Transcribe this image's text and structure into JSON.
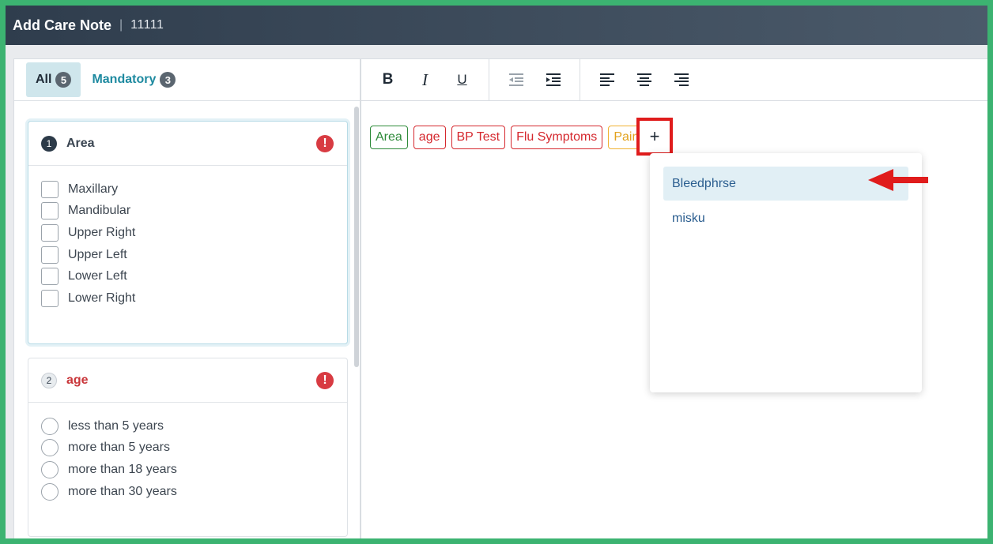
{
  "header": {
    "title": "Add Care Note",
    "separator": "|",
    "code": "11111"
  },
  "tabs": [
    {
      "label": "All",
      "count": "5"
    },
    {
      "label": "Mandatory",
      "count": "3"
    }
  ],
  "cards": [
    {
      "number": "1",
      "title": "Area",
      "alert": "!",
      "options": [
        "Maxillary",
        "Mandibular",
        "Upper Right",
        "Upper Left",
        "Lower Left",
        "Lower Right"
      ]
    },
    {
      "number": "2",
      "title": "age",
      "alert": "!",
      "options": [
        "less than 5 years",
        "more than 5 years",
        "more than 18 years",
        "more than 30 years"
      ]
    }
  ],
  "toolbar": {
    "bold": "B",
    "italic": "I",
    "underline": "U"
  },
  "chips": [
    "Area",
    "age",
    "BP Test",
    "Flu Symptoms",
    "Pain"
  ],
  "add_button": "+",
  "dropdown": {
    "items": [
      "Bleedphrse",
      "misku"
    ]
  },
  "colors": {
    "highlight_border": "#e01c1c",
    "arrow": "#e01c1c",
    "frame": "#3cb371"
  }
}
